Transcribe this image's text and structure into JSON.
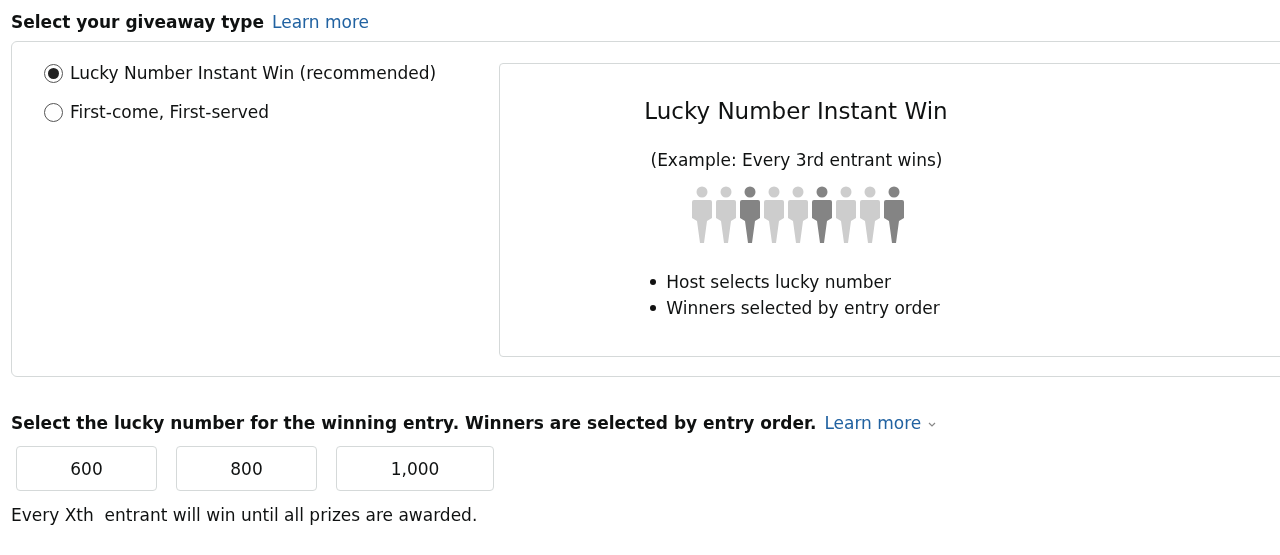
{
  "type_section": {
    "heading": "Select your giveaway type",
    "link": "Learn more"
  },
  "options": [
    {
      "label": "Lucky Number Instant Win (recommended)",
      "selected": true
    },
    {
      "label": "First-come, First-served",
      "selected": false
    }
  ],
  "preview": {
    "title": "Lucky Number Instant Win",
    "example": "(Example: Every 3rd entrant wins)",
    "figures": [
      {
        "highlighted": false
      },
      {
        "highlighted": false
      },
      {
        "highlighted": true
      },
      {
        "highlighted": false
      },
      {
        "highlighted": false
      },
      {
        "highlighted": true
      },
      {
        "highlighted": false
      },
      {
        "highlighted": false
      },
      {
        "highlighted": true
      }
    ],
    "bullets": [
      "Host selects lucky number",
      "Winners selected by entry order"
    ]
  },
  "number_section": {
    "heading": "Select the lucky number for the winning entry. Winners are selected by entry order.",
    "link": "Learn more",
    "numbers": [
      {
        "label": "600",
        "selected": false
      },
      {
        "label": "800",
        "selected": false
      },
      {
        "label": "1,000",
        "selected": false
      }
    ],
    "note": "Every Xth  entrant will win until all prizes are awarded."
  }
}
